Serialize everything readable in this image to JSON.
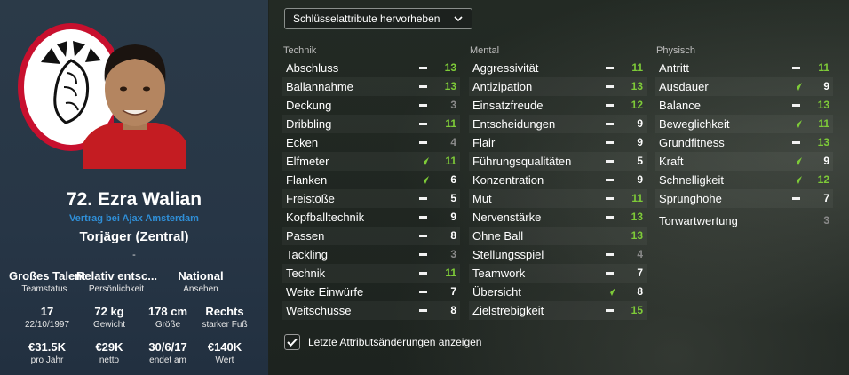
{
  "player": {
    "name": "72. Ezra Walian",
    "contract": "Vertrag bei Ajax Amsterdam",
    "position": "Torjäger (Zentral)",
    "separator": "-",
    "club_logo": "ajax-logo",
    "info": [
      [
        {
          "value": "Großes Talent",
          "label": "Teamstatus"
        },
        {
          "value": "Relativ entsc...",
          "label": "Persönlichkeit"
        },
        {
          "value": "National",
          "label": "Ansehen"
        }
      ],
      [
        {
          "value": "17",
          "label": "22/10/1997"
        },
        {
          "value": "72 kg",
          "label": "Gewicht"
        },
        {
          "value": "178 cm",
          "label": "Größe"
        },
        {
          "value": "Rechts",
          "label": "starker Fuß"
        }
      ],
      [
        {
          "value": "€31.5K",
          "label": "pro Jahr"
        },
        {
          "value": "€29K",
          "label": "netto"
        },
        {
          "value": "30/6/17",
          "label": "endet am"
        },
        {
          "value": "€140K",
          "label": "Wert"
        }
      ]
    ]
  },
  "controls": {
    "highlight_dropdown": "Schlüsselattribute hervorheben",
    "show_changes_label": "Letzte Attributsänderungen anzeigen",
    "show_changes_checked": true
  },
  "colors": {
    "accent_blue": "#2f8fd8",
    "key_green": "#7ecb38",
    "grey_value": "#8a8a8a"
  },
  "attributes": {
    "technik": {
      "title": "Technik",
      "items": [
        {
          "name": "Abschluss",
          "value": "13",
          "trend": "dash",
          "key": true
        },
        {
          "name": "Ballannahme",
          "value": "13",
          "trend": "dash",
          "key": true
        },
        {
          "name": "Deckung",
          "value": "3",
          "trend": "dash",
          "key": false,
          "dim": true
        },
        {
          "name": "Dribbling",
          "value": "11",
          "trend": "dash",
          "key": true
        },
        {
          "name": "Ecken",
          "value": "4",
          "trend": "dash",
          "key": false,
          "dim": true
        },
        {
          "name": "Elfmeter",
          "value": "11",
          "trend": "up",
          "key": true
        },
        {
          "name": "Flanken",
          "value": "6",
          "trend": "up",
          "key": false
        },
        {
          "name": "Freistöße",
          "value": "5",
          "trend": "dash",
          "key": false
        },
        {
          "name": "Kopfballtechnik",
          "value": "9",
          "trend": "dash",
          "key": false
        },
        {
          "name": "Passen",
          "value": "8",
          "trend": "dash",
          "key": false
        },
        {
          "name": "Tackling",
          "value": "3",
          "trend": "dash",
          "key": false,
          "dim": true
        },
        {
          "name": "Technik",
          "value": "11",
          "trend": "dash",
          "key": true
        },
        {
          "name": "Weite Einwürfe",
          "value": "7",
          "trend": "dash",
          "key": false
        },
        {
          "name": "Weitschüsse",
          "value": "8",
          "trend": "dash",
          "key": false
        }
      ]
    },
    "mental": {
      "title": "Mental",
      "items": [
        {
          "name": "Aggressivität",
          "value": "11",
          "trend": "dash",
          "key": true
        },
        {
          "name": "Antizipation",
          "value": "13",
          "trend": "dash",
          "key": true
        },
        {
          "name": "Einsatzfreude",
          "value": "12",
          "trend": "dash",
          "key": true
        },
        {
          "name": "Entscheidungen",
          "value": "9",
          "trend": "dash",
          "key": false
        },
        {
          "name": "Flair",
          "value": "9",
          "trend": "dash",
          "key": false
        },
        {
          "name": "Führungsqualitäten",
          "value": "5",
          "trend": "dash",
          "key": false
        },
        {
          "name": "Konzentration",
          "value": "9",
          "trend": "dash",
          "key": false
        },
        {
          "name": "Mut",
          "value": "11",
          "trend": "dash",
          "key": true
        },
        {
          "name": "Nervenstärke",
          "value": "13",
          "trend": "dash",
          "key": true
        },
        {
          "name": "Ohne Ball",
          "value": "13",
          "trend": "none",
          "key": true
        },
        {
          "name": "Stellungsspiel",
          "value": "4",
          "trend": "dash",
          "key": false,
          "dim": true
        },
        {
          "name": "Teamwork",
          "value": "7",
          "trend": "dash",
          "key": false
        },
        {
          "name": "Übersicht",
          "value": "8",
          "trend": "up",
          "key": false
        },
        {
          "name": "Zielstrebigkeit",
          "value": "15",
          "trend": "dash",
          "key": true
        }
      ]
    },
    "physisch": {
      "title": "Physisch",
      "items": [
        {
          "name": "Antritt",
          "value": "11",
          "trend": "dash",
          "key": true
        },
        {
          "name": "Ausdauer",
          "value": "9",
          "trend": "up",
          "key": false
        },
        {
          "name": "Balance",
          "value": "13",
          "trend": "dash",
          "key": true
        },
        {
          "name": "Beweglichkeit",
          "value": "11",
          "trend": "up",
          "key": true
        },
        {
          "name": "Grundfitness",
          "value": "13",
          "trend": "dash",
          "key": true
        },
        {
          "name": "Kraft",
          "value": "9",
          "trend": "up",
          "key": false
        },
        {
          "name": "Schnelligkeit",
          "value": "12",
          "trend": "up",
          "key": true
        },
        {
          "name": "Sprunghöhe",
          "value": "7",
          "trend": "dash",
          "key": false
        }
      ],
      "extra": {
        "name": "Torwartwertung",
        "value": "3"
      }
    }
  }
}
